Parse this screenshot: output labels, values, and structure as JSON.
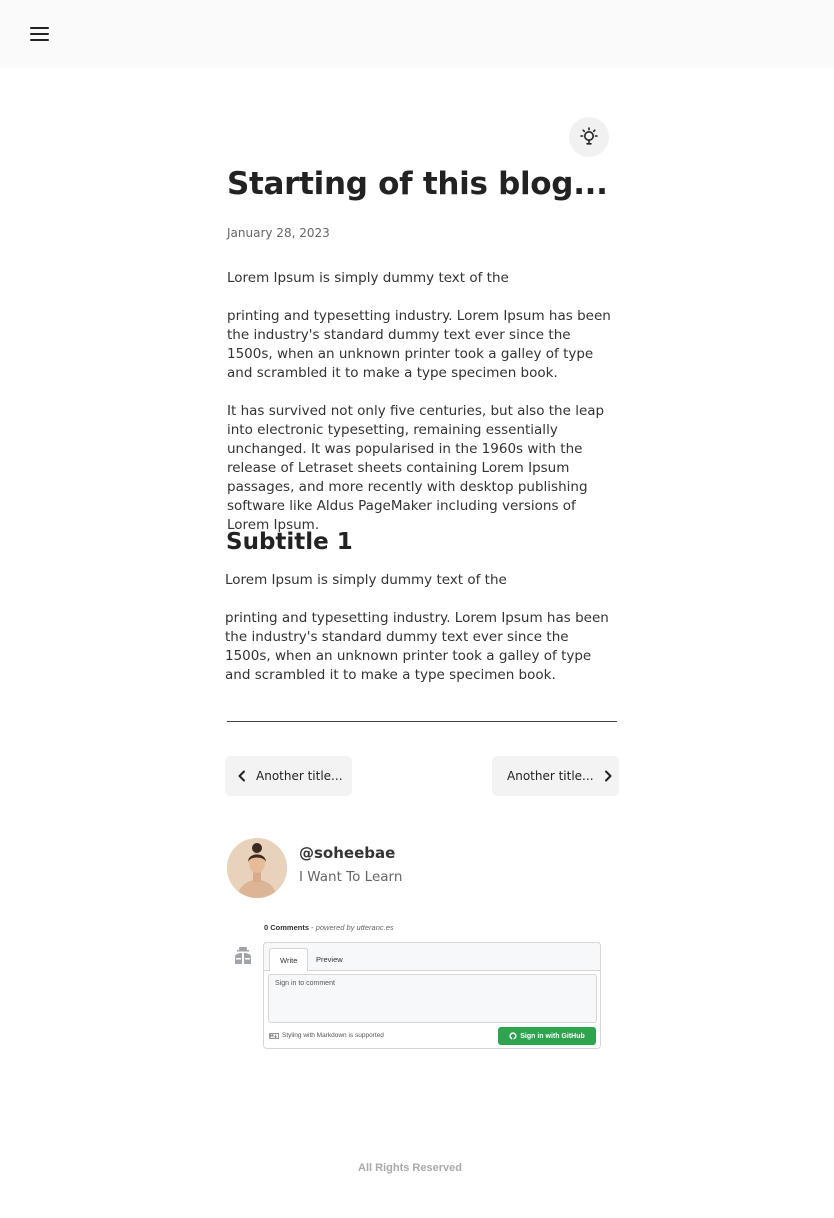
{
  "header": {
    "menu_icon": "hamburger-menu-icon"
  },
  "theme_toggle": {
    "icon": "lightbulb-icon"
  },
  "post": {
    "title": "Starting of this blog...",
    "date": "January 28, 2023",
    "paragraphs": [
      "Lorem Ipsum is simply dummy text of the",
      "printing and typesetting industry. Lorem Ipsum has been the industry's standard dummy text ever since the 1500s, when an unknown printer took a galley of type and scrambled it to make a type specimen book.",
      "It has survived not only five centuries, but also the leap into electronic typesetting, remaining essentially unchanged. It was popularised in the 1960s with the release of Letraset sheets containing Lorem Ipsum passages, and more recently with desktop publishing software like Aldus PageMaker including versions of Lorem Ipsum."
    ],
    "subtitle": "Subtitle 1",
    "subtitle_paragraphs": [
      "Lorem Ipsum is simply dummy text of the",
      "printing and typesetting industry. Lorem Ipsum has been the industry's standard dummy text ever since the 1500s, when an unknown printer took a galley of type and scrambled it to make a type specimen book."
    ]
  },
  "pagination": {
    "prev_label": "Another title...",
    "next_label": "Another title..."
  },
  "author": {
    "handle": "@soheebae",
    "tagline": "I Want To Learn"
  },
  "comments": {
    "count_label": "0 Comments",
    "separator": " - ",
    "powered_by": "powered by utteranc.es",
    "tab_write": "Write",
    "tab_preview": "Preview",
    "placeholder": "Sign in to comment",
    "markdown_note": "Styling with Markdown is supported",
    "signin_label": "Sign in with GitHub",
    "accent": "#2ea44f"
  },
  "footer": {
    "text": "All Rights Reserved"
  }
}
